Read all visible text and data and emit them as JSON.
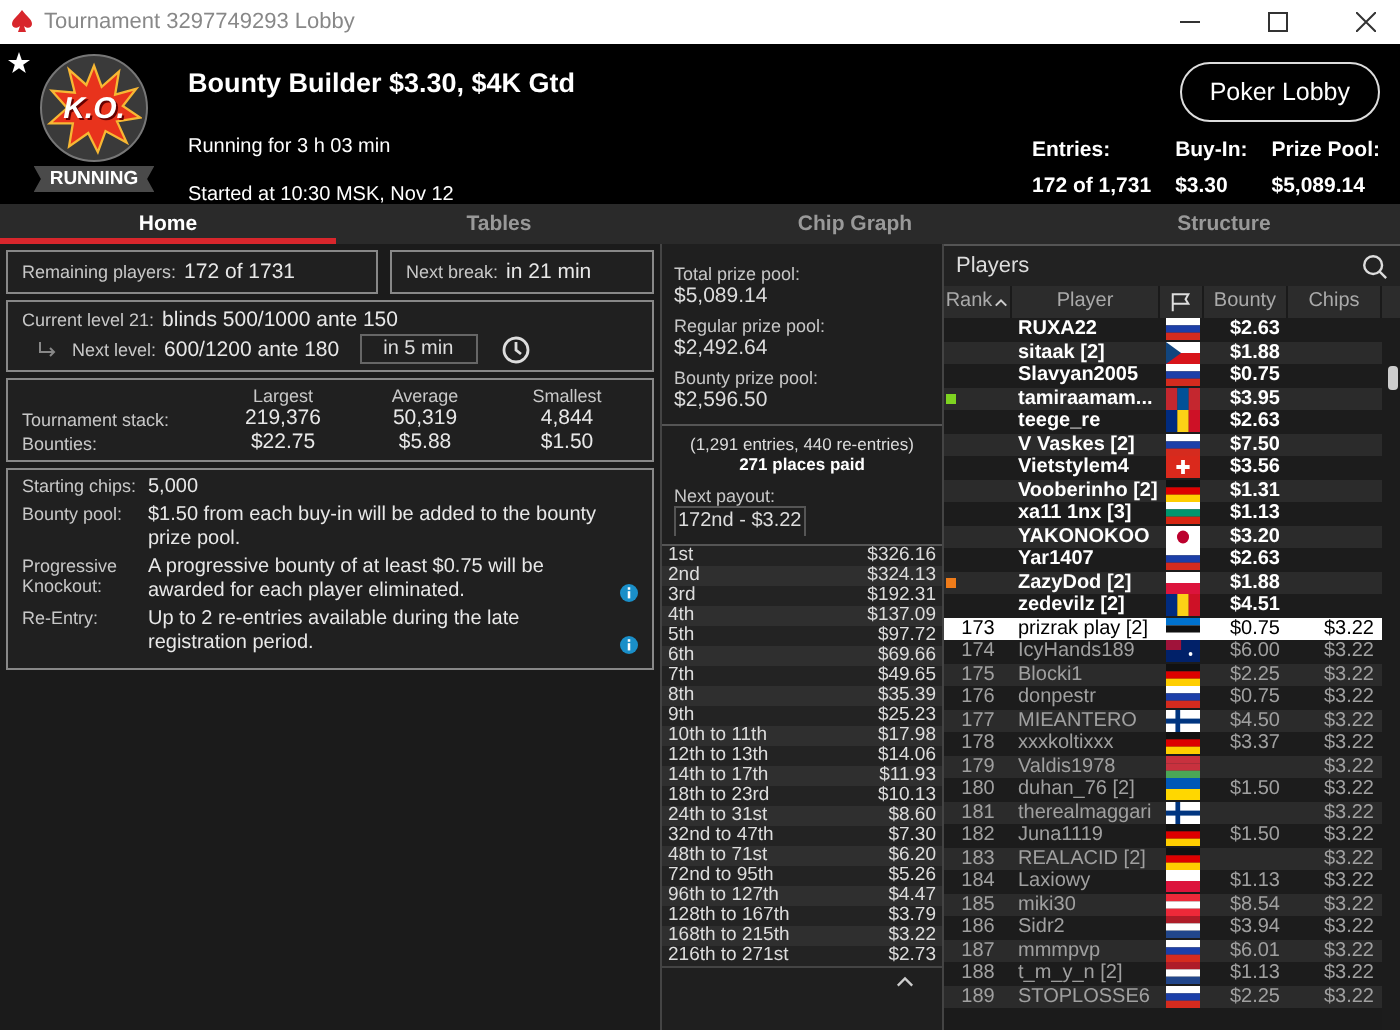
{
  "window": {
    "title": "Tournament 3297749293 Lobby"
  },
  "header": {
    "badge": "K.O.",
    "status": "RUNNING",
    "title": "Bounty Builder $3.30, $4K Gtd",
    "running_for": "Running for 3 h 03 min",
    "started": "Started at 10:30 MSK, Nov 12",
    "lobby_button": "Poker Lobby",
    "stats": [
      {
        "label": "Entries:",
        "value": "172 of 1,731"
      },
      {
        "label": "Buy-In:",
        "value": "$3.30"
      },
      {
        "label": "Prize Pool:",
        "value": "$5,089.14"
      }
    ]
  },
  "tabs": [
    {
      "label": "Home",
      "selected": true
    },
    {
      "label": "Tables",
      "selected": false
    },
    {
      "label": "Chip Graph",
      "selected": false
    },
    {
      "label": "Structure",
      "selected": false
    }
  ],
  "summary": {
    "remaining_label": "Remaining players:",
    "remaining_value": "172 of 1731",
    "break_label": "Next break:",
    "break_value": "in 21 min"
  },
  "levels": {
    "current_label": "Current level 21:",
    "current_value": "blinds 500/1000 ante 150",
    "next_label": "Next level:",
    "next_value": "600/1200 ante 180",
    "timer": "in 5 min"
  },
  "stacks": {
    "columns": [
      "Largest",
      "Average",
      "Smallest"
    ],
    "rows": [
      {
        "label": "Tournament stack:",
        "values": [
          "219,376",
          "50,319",
          "4,844"
        ]
      },
      {
        "label": "Bounties:",
        "values": [
          "$22.75",
          "$5.88",
          "$1.50"
        ]
      }
    ]
  },
  "info": [
    {
      "label": "Starting chips:",
      "value": "5,000",
      "info": false
    },
    {
      "label": "Bounty pool:",
      "value": "$1.50 from each buy-in will be added to the bounty prize pool.",
      "info": false
    },
    {
      "label": "Progressive Knockout:",
      "value": "A progressive bounty of at least $0.75 will be awarded for each player eliminated.",
      "info": true
    },
    {
      "label": "Re-Entry:",
      "value": "Up to 2 re-entries available during the late registration period.",
      "info": true
    }
  ],
  "prize_pools": [
    {
      "label": "Total prize pool:",
      "value": "$5,089.14"
    },
    {
      "label": "Regular prize pool:",
      "value": "$2,492.64"
    },
    {
      "label": "Bounty prize pool:",
      "value": "$2,596.50"
    }
  ],
  "entries_note": "(1,291 entries, 440 re-entries)",
  "places_paid": "271 places paid",
  "next_payout": {
    "label": "Next payout:",
    "value": "172nd - $3.22"
  },
  "payouts": [
    {
      "place": "1st",
      "prize": "$326.16"
    },
    {
      "place": "2nd",
      "prize": "$324.13"
    },
    {
      "place": "3rd",
      "prize": "$192.31"
    },
    {
      "place": "4th",
      "prize": "$137.09"
    },
    {
      "place": "5th",
      "prize": "$97.72"
    },
    {
      "place": "6th",
      "prize": "$69.66"
    },
    {
      "place": "7th",
      "prize": "$49.65"
    },
    {
      "place": "8th",
      "prize": "$35.39"
    },
    {
      "place": "9th",
      "prize": "$25.23"
    },
    {
      "place": "10th to 11th",
      "prize": "$17.98"
    },
    {
      "place": "12th to 13th",
      "prize": "$14.06"
    },
    {
      "place": "14th to 17th",
      "prize": "$11.93"
    },
    {
      "place": "18th to 23rd",
      "prize": "$10.13"
    },
    {
      "place": "24th to 31st",
      "prize": "$8.60"
    },
    {
      "place": "32nd to 47th",
      "prize": "$7.30"
    },
    {
      "place": "48th to 71st",
      "prize": "$6.20"
    },
    {
      "place": "72nd to 95th",
      "prize": "$5.26"
    },
    {
      "place": "96th to 127th",
      "prize": "$4.47"
    },
    {
      "place": "128th to 167th",
      "prize": "$3.79"
    },
    {
      "place": "168th to 215th",
      "prize": "$3.22"
    },
    {
      "place": "216th to 271st",
      "prize": "$2.73"
    }
  ],
  "players": {
    "title": "Players",
    "columns": [
      "Rank",
      "Player",
      "Bounty",
      "Chips"
    ],
    "rows": [
      {
        "player": "RUXA22",
        "kind": "ru",
        "bounty": "$2.63",
        "eliminated": false,
        "selected": false
      },
      {
        "player": "sitaak [2]",
        "kind": "cz",
        "bounty": "$1.88",
        "eliminated": false,
        "selected": false
      },
      {
        "player": "Slavyan2005",
        "kind": "ru",
        "bounty": "$0.75",
        "eliminated": false,
        "selected": false
      },
      {
        "player": "tamiraamam...",
        "kind": "mn",
        "bounty": "$3.95",
        "eliminated": false,
        "selected": false,
        "color": "#7ed321"
      },
      {
        "player": "teege_re",
        "kind": "ro",
        "bounty": "$2.63",
        "eliminated": false,
        "selected": false
      },
      {
        "player": "V Vaskes [2]",
        "kind": "ru",
        "bounty": "$7.50",
        "eliminated": false,
        "selected": false
      },
      {
        "player": "Vietstylem4",
        "kind": "ch",
        "bounty": "$3.56",
        "eliminated": false,
        "selected": false
      },
      {
        "player": "Vooberinho [2]",
        "kind": "de",
        "bounty": "$1.31",
        "eliminated": false,
        "selected": false
      },
      {
        "player": "xa11 1nx [3]",
        "kind": "bg",
        "bounty": "$1.13",
        "eliminated": false,
        "selected": false
      },
      {
        "player": "YAKONOKOO",
        "kind": "jp",
        "bounty": "$3.20",
        "eliminated": false,
        "selected": false
      },
      {
        "player": "Yar1407",
        "kind": "ru",
        "bounty": "$2.63",
        "eliminated": false,
        "selected": false
      },
      {
        "player": "ZazyDod [2]",
        "kind": "pl",
        "bounty": "$1.88",
        "eliminated": false,
        "selected": false,
        "color": "#f07c1a"
      },
      {
        "player": "zedevilz [2]",
        "kind": "ro",
        "bounty": "$4.51",
        "eliminated": false,
        "selected": false
      },
      {
        "rank": "173",
        "player": "prizrak play [2]",
        "kind": "ee",
        "bounty": "$0.75",
        "chips": "$3.22",
        "eliminated": true,
        "selected": true
      },
      {
        "rank": "174",
        "player": "IcyHands189",
        "kind": "au",
        "bounty": "$6.00",
        "chips": "$3.22",
        "eliminated": true,
        "selected": false
      },
      {
        "rank": "175",
        "player": "Blocki1",
        "kind": "de",
        "bounty": "$2.25",
        "chips": "$3.22",
        "eliminated": true,
        "selected": false
      },
      {
        "rank": "176",
        "player": "donpestr",
        "kind": "ru",
        "bounty": "$0.75",
        "chips": "$3.22",
        "eliminated": true,
        "selected": false
      },
      {
        "rank": "177",
        "player": "MIEANTERO",
        "kind": "fi",
        "bounty": "$4.50",
        "chips": "$3.22",
        "eliminated": true,
        "selected": false
      },
      {
        "rank": "178",
        "player": "xxxkoltixxx",
        "kind": "de",
        "bounty": "$3.37",
        "chips": "$3.22",
        "eliminated": true,
        "selected": false
      },
      {
        "rank": "179",
        "player": "Valdis1978",
        "kind": "by",
        "chips": "$3.22",
        "eliminated": true,
        "selected": false
      },
      {
        "rank": "180",
        "player": "duhan_76 [2]",
        "kind": "ua",
        "bounty": "$1.50",
        "chips": "$3.22",
        "eliminated": true,
        "selected": false
      },
      {
        "rank": "181",
        "player": "therealmaggari",
        "kind": "fi",
        "chips": "$3.22",
        "eliminated": true,
        "selected": false
      },
      {
        "rank": "182",
        "player": "Juna1119",
        "kind": "de",
        "bounty": "$1.50",
        "chips": "$3.22",
        "eliminated": true,
        "selected": false
      },
      {
        "rank": "183",
        "player": "REALACID [2]",
        "kind": "de",
        "chips": "$3.22",
        "eliminated": true,
        "selected": false
      },
      {
        "rank": "184",
        "player": "Laxiowy",
        "kind": "pl",
        "bounty": "$1.13",
        "chips": "$3.22",
        "eliminated": true,
        "selected": false
      },
      {
        "rank": "185",
        "player": "miki30",
        "kind": "at",
        "bounty": "$8.54",
        "chips": "$3.22",
        "eliminated": true,
        "selected": false
      },
      {
        "rank": "186",
        "player": "Sidr2",
        "kind": "nl",
        "bounty": "$3.94",
        "chips": "$3.22",
        "eliminated": true,
        "selected": false
      },
      {
        "rank": "187",
        "player": "mmmpvp",
        "kind": "ru",
        "bounty": "$6.01",
        "chips": "$3.22",
        "eliminated": true,
        "selected": false
      },
      {
        "rank": "188",
        "player": "t_m_y_n [2]",
        "kind": "nl",
        "bounty": "$1.13",
        "chips": "$3.22",
        "eliminated": true,
        "selected": false
      },
      {
        "rank": "189",
        "player": "STOPLOSSE6",
        "kind": "ru",
        "bounty": "$2.25",
        "chips": "$3.22",
        "eliminated": true,
        "selected": false
      }
    ]
  }
}
